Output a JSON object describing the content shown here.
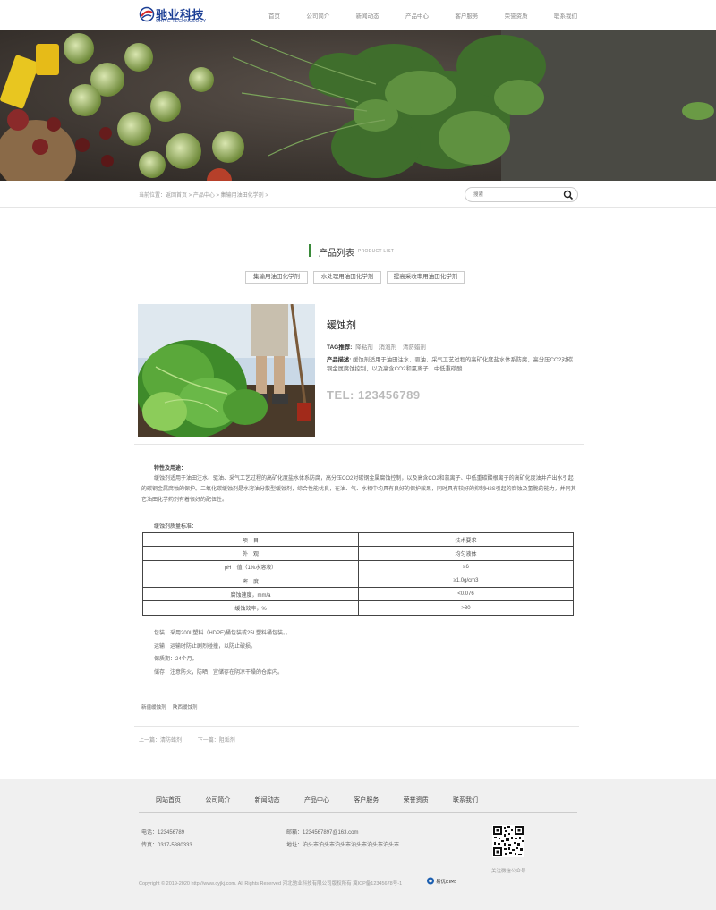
{
  "brand": {
    "name_cn": "驰业科技",
    "name_en": "CHIYE TECHNOLOGY",
    "color": "#1c3f95"
  },
  "nav": [
    "首页",
    "公司简介",
    "新闻动态",
    "产品中心",
    "客户服务",
    "荣誉资质",
    "联系我们"
  ],
  "breadcrumb": "当前位置：返回首页 > 产品中心 > 集输用油田化学剂 >",
  "search": {
    "placeholder": "搜索"
  },
  "section": {
    "title_cn": "产品列表",
    "title_en": "PRODUCT LIST",
    "accent": "#3a8a3a"
  },
  "categories": [
    "集输用油田化学剂",
    "水处理用油田化学剂",
    "提高采收率用油田化学剂"
  ],
  "product": {
    "name": "缓蚀剂",
    "tag_label": "TAG推荐:",
    "tags": [
      "降粘剂",
      "消泡剂",
      "清防蜡剂"
    ],
    "desc_label": "产品描述:",
    "desc": "缓蚀剂适用于油田注水、驱油、采气工艺过程的高矿化度盐水体系防腐，高分压CO2对碳钢金属腐蚀控制，以及高含CO2和氯离子、中低重碳酸...",
    "tel": "TEL: 123456789"
  },
  "article": {
    "heading": "特性及用途：",
    "paragraph": "缓蚀剂适用于油田注水、驱油、采气工艺过程的高矿化度盐水体系防腐，高分压CO2对碳钢金属腐蚀控制，以及高含CO2和氯离子、中低重碳酸根离子的高矿化度油井产出水引起的碳钢金属腐蚀的保护。二氧化碳缓蚀剂是水溶油分散型缓蚀剂，综合性能优良，在油、气、水相中均具有良好的保护效果，同时具有较好的抑制H2S引起的腐蚀及氢脆的能力，并同其它油田化学药剂有着很好的配伍性。",
    "table_title": "缓蚀剂质量标准：",
    "table": [
      [
        "项　目",
        "技术要求"
      ],
      [
        "外　观",
        "均匀液体"
      ],
      [
        "pH　值（1%水溶液）",
        "≥6"
      ],
      [
        "密　度",
        "≥1.0g/cm3"
      ],
      [
        "腐蚀速度，mm/a",
        "<0.076"
      ],
      [
        "缓蚀效率，%",
        ">80"
      ]
    ],
    "notes": [
      "包装：采用200L塑料（HDPE)桶包装或25L塑料桶包装。。",
      "运输：运输时防止剧烈碰撞，以防止破损。",
      "保质期：24个月。",
      "储存：注意防火，防晒，宜储存在阴凉干燥的仓库内。"
    ]
  },
  "tags_bottom": [
    "新疆缓蚀剂",
    "陕西缓蚀剂"
  ],
  "prev": "上一篇：清防蜡剂",
  "next": "下一篇：阻垢剂",
  "footer": {
    "nav": [
      "网站首页",
      "公司简介",
      "新闻动态",
      "产品中心",
      "客户服务",
      "荣誉资质",
      "联系我们"
    ],
    "phone": "电话：123456789",
    "fax": "传真：0317-5880333",
    "email": "邮箱：1234567897@163.com",
    "address": "地址：泊头市泊头市泊头市泊头市泊头市泊头市",
    "qr_caption": "关注微信公众号",
    "copyright": "Copyright © 2019-2020 http://www.cyjkj.com. All Rights Reserved 河北驰业科技有限公司版权所有 冀ICP备12345678号-1",
    "badge": "易优EIMS"
  }
}
